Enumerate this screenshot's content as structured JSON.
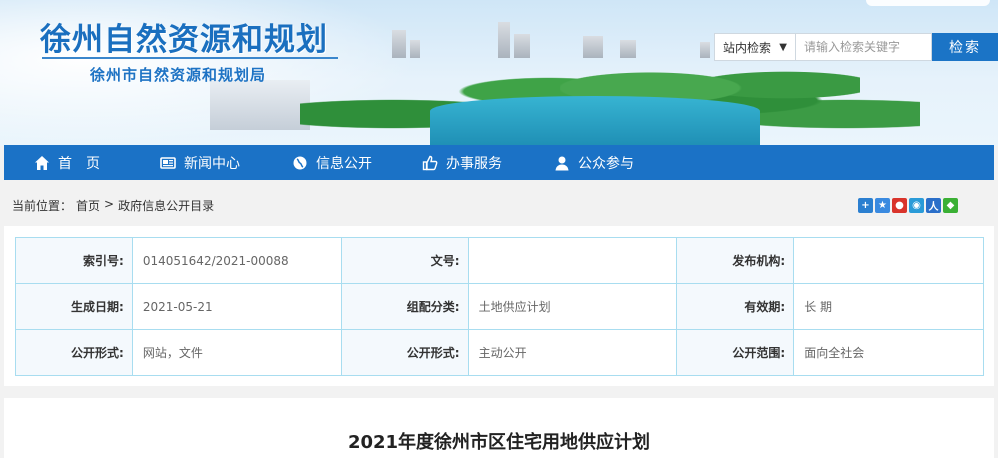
{
  "header": {
    "site_title": "徐州自然资源和规划",
    "site_subtitle": "徐州市自然资源和规划局"
  },
  "search": {
    "scope": "站内检索",
    "placeholder": "请输入检索关键字",
    "button": "检索"
  },
  "nav": {
    "items": [
      {
        "label": "首　页",
        "icon": "home-icon"
      },
      {
        "label": "新闻中心",
        "icon": "newspaper-icon"
      },
      {
        "label": "信息公开",
        "icon": "globe-icon"
      },
      {
        "label": "办事服务",
        "icon": "thumbs-up-icon"
      },
      {
        "label": "公众参与",
        "icon": "user-icon"
      }
    ]
  },
  "breadcrumb": {
    "prefix": "当前位置：",
    "home": "首页",
    "sep": ">",
    "current": "政府信息公开目录"
  },
  "meta": {
    "rows": [
      [
        {
          "label": "索引号:",
          "value": "014051642/2021-00088"
        },
        {
          "label": "文号:",
          "value": ""
        },
        {
          "label": "发布机构:",
          "value": ""
        }
      ],
      [
        {
          "label": "生成日期:",
          "value": "2021-05-21"
        },
        {
          "label": "组配分类:",
          "value": "土地供应计划"
        },
        {
          "label": "有效期:",
          "value": "长 期"
        }
      ],
      [
        {
          "label": "公开形式:",
          "value": "网站，文件"
        },
        {
          "label": "公开形式:",
          "value": "主动公开"
        },
        {
          "label": "公开范围:",
          "value": "面向全社会"
        }
      ]
    ]
  },
  "article": {
    "title": "2021年度徐州市区住宅用地供应计划"
  },
  "colors": {
    "primary": "#1b72c6",
    "table_border": "#a8ddf0",
    "title_blue": "#1a6fbf"
  }
}
